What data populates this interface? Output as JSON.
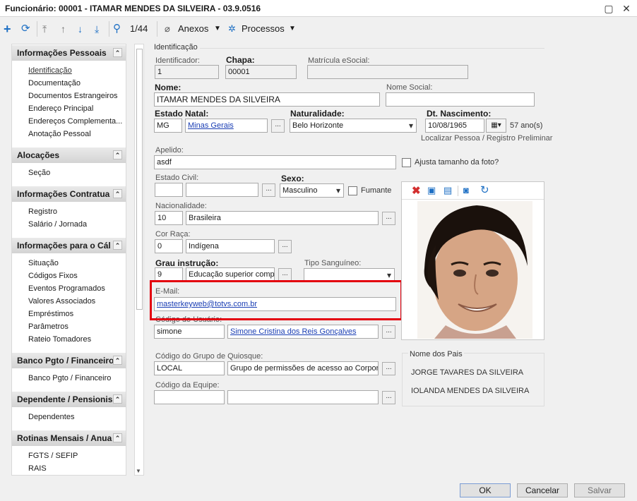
{
  "window": {
    "title": "Funcionário: 00001 - ITAMAR MENDES DA SILVEIRA - 03.9.0516",
    "minimize": "▢",
    "close": "✕"
  },
  "toolbar": {
    "record_position": "1/44",
    "attachments": "Anexos",
    "processes": "Processos"
  },
  "nav": {
    "sections": [
      {
        "title": "Informações Pessoais",
        "items": [
          "Identificação",
          "Documentação",
          "Documentos Estrangeiros",
          "Endereço Principal",
          "Endereços Complementa...",
          "Anotação Pessoal"
        ]
      },
      {
        "title": "Alocações",
        "items": [
          "Seção"
        ]
      },
      {
        "title": "Informações Contratua",
        "items": [
          "Registro",
          "Salário / Jornada"
        ]
      },
      {
        "title": "Informações para o Cál",
        "items": [
          "Situação",
          "Códigos Fixos",
          "Eventos Programados",
          "Valores Associados",
          "Empréstimos",
          "Parâmetros",
          "Rateio Tomadores"
        ]
      },
      {
        "title": "Banco Pgto / Financeiro",
        "items": [
          "Banco Pgto / Financeiro"
        ]
      },
      {
        "title": "Dependente / Pensionis",
        "items": [
          "Dependentes"
        ]
      },
      {
        "title": "Rotinas Mensais / Anua",
        "items": [
          "FGTS / SEFIP",
          "RAIS"
        ]
      }
    ]
  },
  "form": {
    "section_title": "Identificação",
    "identificador": {
      "label": "Identificador:",
      "value": "1"
    },
    "chapa": {
      "label": "Chapa:",
      "value": "00001"
    },
    "matricula": {
      "label": "Matrícula eSocial:",
      "value": ""
    },
    "nome": {
      "label": "Nome:",
      "value": "ITAMAR MENDES DA SILVEIRA"
    },
    "nome_social": {
      "label": "Nome Social:",
      "value": ""
    },
    "estado_natal": {
      "label_estado": "Estado",
      "label_natal": "Natal:",
      "uf": "MG",
      "estado": "Minas Gerais"
    },
    "naturalidade": {
      "label": "Naturalidade:",
      "value": "Belo Horizonte"
    },
    "nascimento": {
      "label": "Dt. Nascimento:",
      "value": "10/08/1965",
      "age": "57 ano(s)"
    },
    "localizar_link": "Localizar Pessoa / Registro Preliminar",
    "apelido": {
      "label": "Apelido:",
      "value": "asdf"
    },
    "ajusta_foto": "Ajusta tamanho da foto?",
    "estado_civil": {
      "label": "Estado Civil:",
      "code": "",
      "value": ""
    },
    "sexo": {
      "label": "Sexo:",
      "value": "Masculino"
    },
    "fumante": "Fumante",
    "nacionalidade": {
      "label": "Nacionalidade:",
      "code": "10",
      "value": "Brasileira"
    },
    "cor_raca": {
      "label": "Cor Raça:",
      "code": "0",
      "value": "Indígena"
    },
    "grau_instrucao": {
      "label": "Grau instrução:",
      "code": "9",
      "value": "Educação superior compl"
    },
    "tipo_sanguineo": {
      "label": "Tipo Sanguíneo:",
      "value": ""
    },
    "email": {
      "label": "E-Mail:",
      "value": "masterkeyweb@totvs.com.br"
    },
    "usuario": {
      "label": "Código do Usuário:",
      "code": "simone",
      "name": "Simone Cristina dos Reis Gonçalves"
    },
    "quiosque": {
      "label": "Código do Grupo de Quiosque:",
      "code": "LOCAL",
      "value": "Grupo de permissões de acesso ao Corporel"
    },
    "equipe": {
      "label": "Código da Equipe:",
      "code": "",
      "value": ""
    },
    "pais": {
      "title": "Nome dos Pais",
      "father": "JORGE TAVARES DA SILVEIRA",
      "mother": "IOLANDA  MENDES DA SILVEIRA"
    },
    "ellipsis": "..."
  },
  "footer": {
    "ok": "OK",
    "cancel": "Cancelar",
    "save": "Salvar"
  }
}
